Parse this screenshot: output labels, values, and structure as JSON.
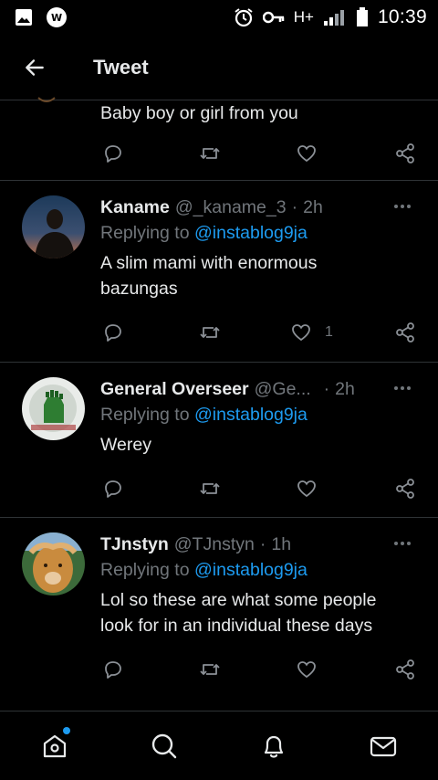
{
  "status_bar": {
    "network": "H+",
    "time": "10:39",
    "icons": [
      "gallery-icon",
      "app-notification-icon",
      "alarm-icon",
      "vpn-key-icon",
      "signal-icon",
      "battery-icon"
    ]
  },
  "header": {
    "title": "Tweet",
    "back_icon": "arrow-left-icon"
  },
  "tweets": [
    {
      "name": "",
      "handle": "",
      "time": "",
      "replying_label": "",
      "replying_to": "",
      "text": "Baby boy or girl from you",
      "likes": ""
    },
    {
      "name": "Kaname",
      "handle": "@_kaname_3",
      "time": "2h",
      "replying_label": "Replying to",
      "replying_to": "@instablog9ja",
      "text": "A slim mami with enormous bazungas",
      "likes": "1"
    },
    {
      "name": "General Overseer",
      "handle": "@Ge...",
      "time": "2h",
      "replying_label": "Replying to",
      "replying_to": "@instablog9ja",
      "text": "Werey",
      "likes": ""
    },
    {
      "name": "TJnstyn",
      "handle": "@TJnstyn",
      "time": "1h",
      "replying_label": "Replying to",
      "replying_to": "@instablog9ja",
      "text": "Lol so these are what some people look for in an individual these days",
      "likes": ""
    }
  ],
  "separator": "·",
  "colors": {
    "background": "#000000",
    "text": "#e7e9ea",
    "muted": "#71767b",
    "accent": "#1d9bf0",
    "divider": "#2f3336"
  },
  "bottom_nav": [
    "home-icon",
    "search-icon",
    "notifications-bell-icon",
    "messages-envelope-icon"
  ]
}
